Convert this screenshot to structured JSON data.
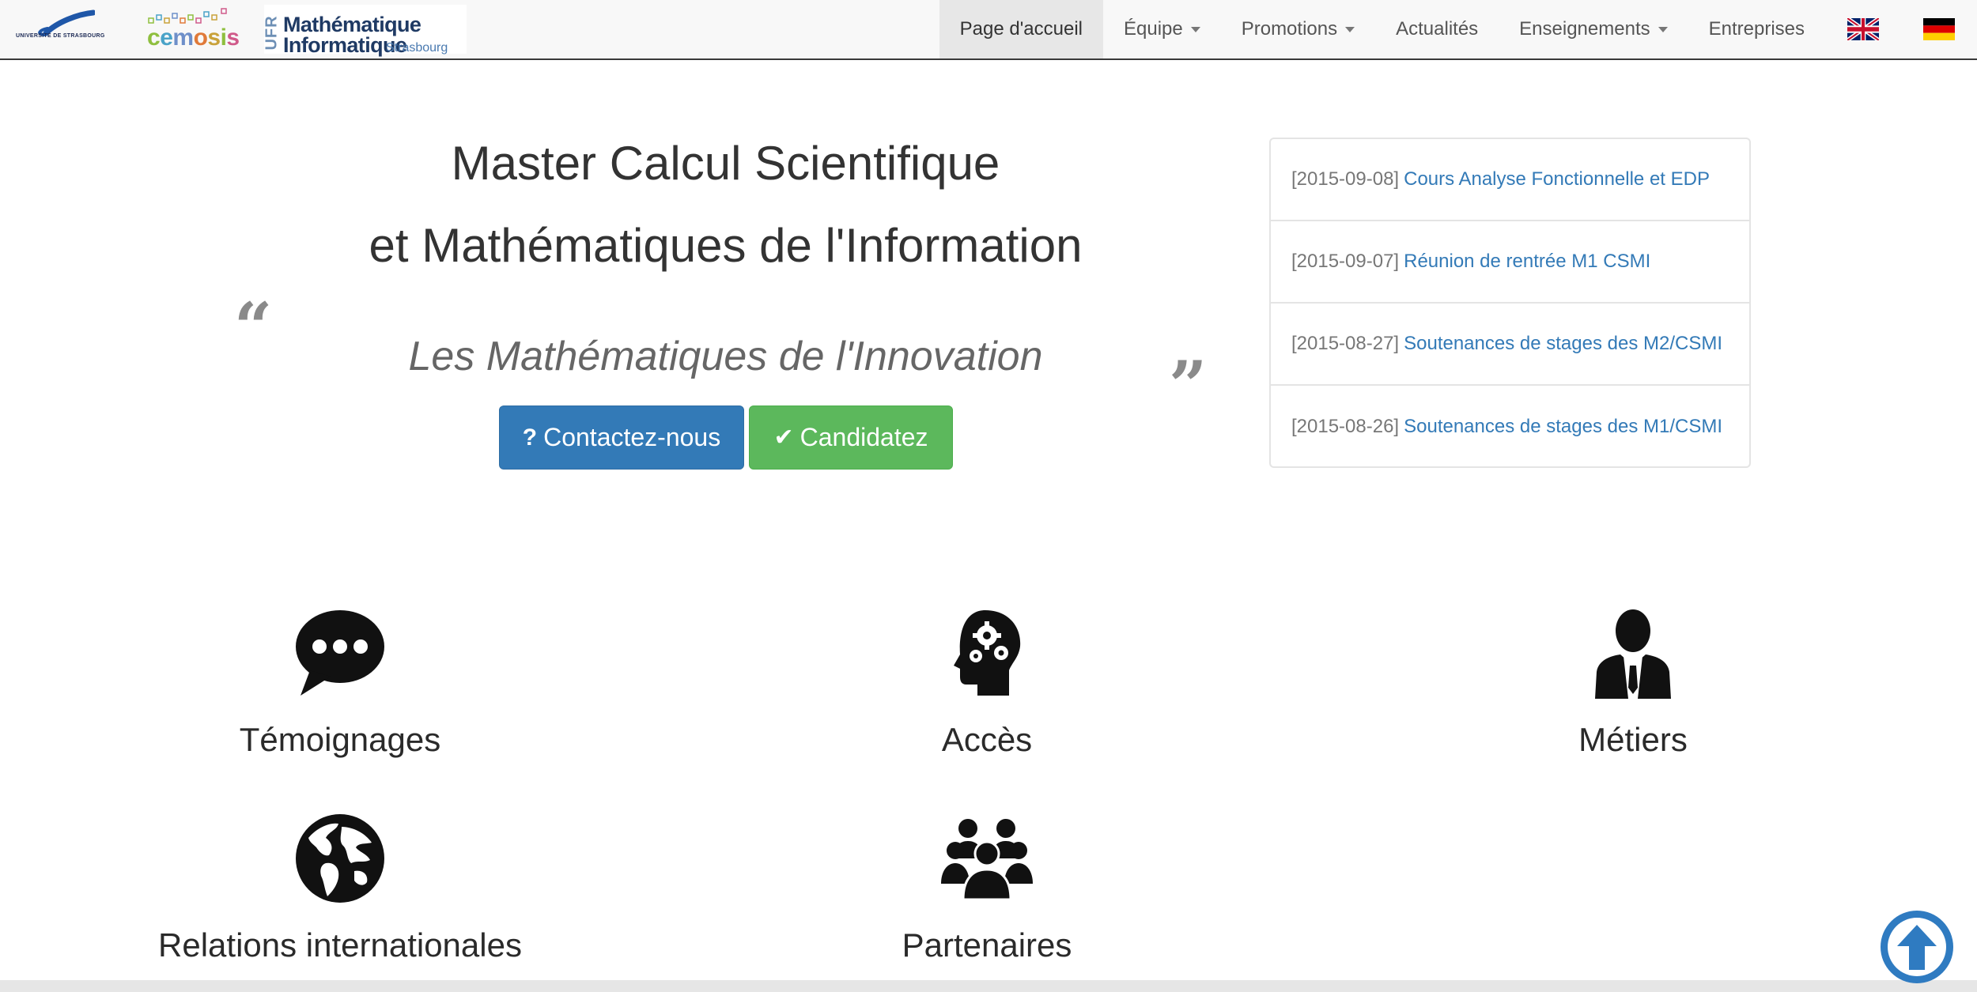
{
  "logos": {
    "unistra_text": "UNIVERSITÉ DE STRASBOURG",
    "cemosis_letters": [
      "c",
      "e",
      "m",
      "o",
      "s",
      "i",
      "s"
    ],
    "ufr_vertical": "UFR",
    "ufr_line1": "Mathématique",
    "ufr_line2": "Informatique",
    "ufr_city": "Strasbourg"
  },
  "nav": {
    "items": [
      {
        "label": "Page d'accueil",
        "active": true,
        "dropdown": false
      },
      {
        "label": "Équipe",
        "active": false,
        "dropdown": true
      },
      {
        "label": "Promotions",
        "active": false,
        "dropdown": true
      },
      {
        "label": "Actualités",
        "active": false,
        "dropdown": false
      },
      {
        "label": "Enseignements",
        "active": false,
        "dropdown": true
      },
      {
        "label": "Entreprises",
        "active": false,
        "dropdown": false
      }
    ],
    "flags": [
      "uk-flag-icon",
      "germany-flag-icon"
    ]
  },
  "hero": {
    "title_line1": "Master Calcul Scientifique",
    "title_line2": "et Mathématiques de l'Information",
    "quote_open": "“",
    "quote_close": "”",
    "slogan": "Les Mathématiques de l'Innovation",
    "contact_icon": "?",
    "contact_label": "Contactez-nous",
    "apply_icon": "✔",
    "apply_label": "Candidatez"
  },
  "news": [
    {
      "date": "[2015-09-08]",
      "title": "Cours Analyse Fonctionnelle et EDP"
    },
    {
      "date": "[2015-09-07]",
      "title": "Réunion de rentrée M1 CSMI"
    },
    {
      "date": "[2015-08-27]",
      "title": "Soutenances de stages des M2/CSMI"
    },
    {
      "date": "[2015-08-26]",
      "title": "Soutenances de stages des M1/CSMI"
    }
  ],
  "features": [
    {
      "label": "Témoignages",
      "icon": "speech-bubble-icon"
    },
    {
      "label": "Accès",
      "icon": "head-gears-icon"
    },
    {
      "label": "Métiers",
      "icon": "businessman-icon"
    },
    {
      "label": "Relations internationales",
      "icon": "globe-icon"
    },
    {
      "label": "Partenaires",
      "icon": "group-icon"
    }
  ],
  "colors": {
    "primary": "#337ab7",
    "success": "#5cb85c",
    "link": "#337ab7",
    "navbar_bg": "#f8f8f8",
    "active_nav_bg": "#e7e7e7"
  }
}
